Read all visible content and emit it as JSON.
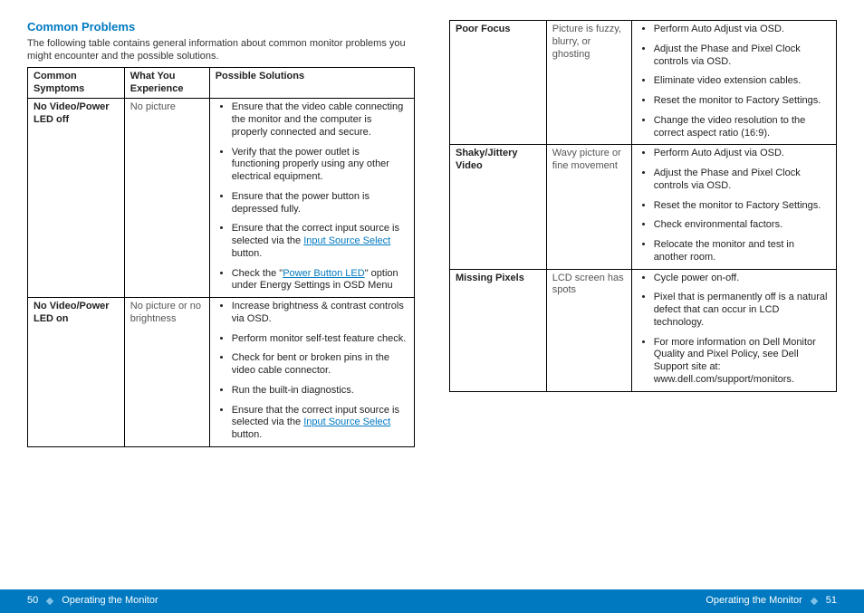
{
  "section_title": "Common Problems",
  "intro": "The following table contains general information about common monitor problems you might encounter and the possible solutions.",
  "headers": {
    "symptoms": "Common Symptoms",
    "experience": "What You Experience",
    "solutions": "Possible Solutions"
  },
  "links": {
    "input_source_select": "Input Source Select",
    "power_button_led": "Power Button LED"
  },
  "rows_left": [
    {
      "symptom": "No Video/Power LED off",
      "experience": "No picture",
      "solutions": [
        "Ensure that the video cable connecting the monitor and the computer is properly connected and secure.",
        "Verify that the power outlet is functioning properly using any other electrical equipment.",
        "Ensure that the power button is depressed fully.",
        {
          "pre": "Ensure that the correct input source is selected via the ",
          "link": "input_source_select",
          "post": " button."
        },
        {
          "pre": "Check the \"",
          "link": "power_button_led",
          "post": "\" option under Energy Settings in OSD Menu"
        }
      ]
    },
    {
      "symptom": "No Video/Power LED on",
      "experience": "No picture or no brightness",
      "solutions": [
        "Increase brightness & contrast controls via OSD.",
        "Perform monitor self-test feature check.",
        "Check for bent or broken pins in the video cable connector.",
        "Run the built-in diagnostics.",
        {
          "pre": "Ensure that the correct input source is selected via the ",
          "link": "input_source_select",
          "post": " button."
        }
      ]
    }
  ],
  "rows_right": [
    {
      "symptom": "Poor Focus",
      "experience": "Picture is fuzzy, blurry, or ghosting",
      "solutions": [
        "Perform Auto Adjust via OSD.",
        "Adjust the Phase and Pixel Clock controls via OSD.",
        "Eliminate video extension cables.",
        "Reset the monitor to Factory Settings.",
        "Change the video resolution to the correct aspect ratio (16:9)."
      ]
    },
    {
      "symptom": "Shaky/Jittery Video",
      "experience": "Wavy picture or fine movement",
      "solutions": [
        "Perform Auto Adjust via OSD.",
        "Adjust the Phase and Pixel Clock controls via OSD.",
        "Reset the monitor to Factory Settings.",
        "Check environmental factors.",
        "Relocate the monitor and test in another room."
      ]
    },
    {
      "symptom": "Missing Pixels",
      "experience": "LCD screen has spots",
      "solutions": [
        "Cycle power on-off.",
        "Pixel that is permanently off is a natural defect that can occur in LCD technology.",
        "For more information on Dell Monitor Quality and Pixel Policy, see Dell Support site at: www.dell.com/support/monitors."
      ]
    }
  ],
  "footer": {
    "left_page": "50",
    "right_page": "51",
    "section": "Operating the Monitor"
  }
}
